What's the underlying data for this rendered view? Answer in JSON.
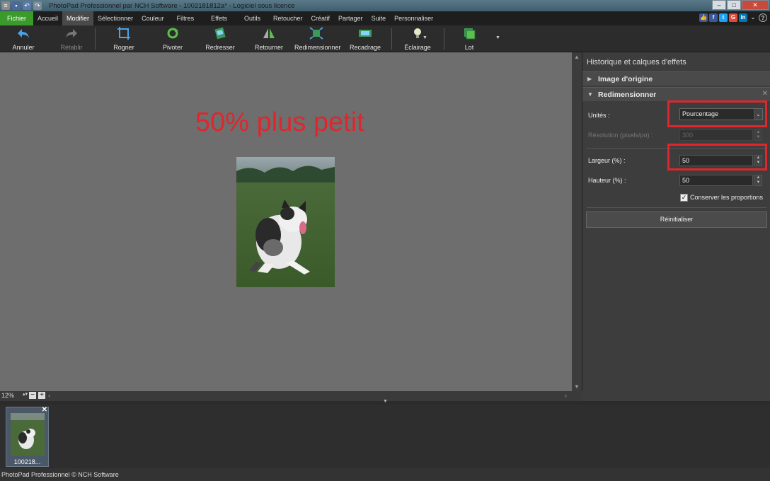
{
  "app": {
    "title": "PhotoPad Professionnel par NCH Software - 1002181812a* - Logiciel sous licence",
    "status": "PhotoPad Professionnel © NCH Software"
  },
  "menu": {
    "items": [
      "Fichier",
      "Accueil",
      "Modifier",
      "Sélectionner",
      "Couleur",
      "Filtres",
      "Effets",
      "Outils",
      "Retoucher",
      "Créatif",
      "Partager",
      "Suite",
      "Personnaliser"
    ],
    "active": "Modifier"
  },
  "social": [
    "thumbs-up-icon",
    "facebook-icon",
    "twitter-icon",
    "google-plus-icon",
    "linkedin-icon"
  ],
  "toolbar": {
    "annuler": "Annuler",
    "retablir": "Rétablir",
    "rogner": "Rogner",
    "pivoter": "Pivoter",
    "redresser": "Redresser",
    "retourner": "Retourner",
    "redimensionner": "Redimensionner",
    "recadrage": "Recadrage",
    "eclairage": "Éclairage",
    "lot": "Lot"
  },
  "canvas": {
    "overlay_text": "50% plus petit",
    "zoom": "12%"
  },
  "filmstrip": {
    "thumb_label": "100218..."
  },
  "panel": {
    "title": "Historique et calques d'effets",
    "section_original": "Image d'origine",
    "section_resize": "Redimensionner",
    "units_label": "Unités :",
    "units_value": "Pourcentage",
    "resolution_label": "Résolution (pixels/po) :",
    "resolution_value": "300",
    "width_label": "Largeur (%) :",
    "width_value": "50",
    "height_label": "Hauteur (%) :",
    "height_value": "50",
    "keep_ratio_label": "Conserver les proportions",
    "keep_ratio_checked": true,
    "reset_button": "Réinitialiser"
  },
  "colors": {
    "accent_red": "#e0262c",
    "file_green": "#3a9a2a"
  }
}
